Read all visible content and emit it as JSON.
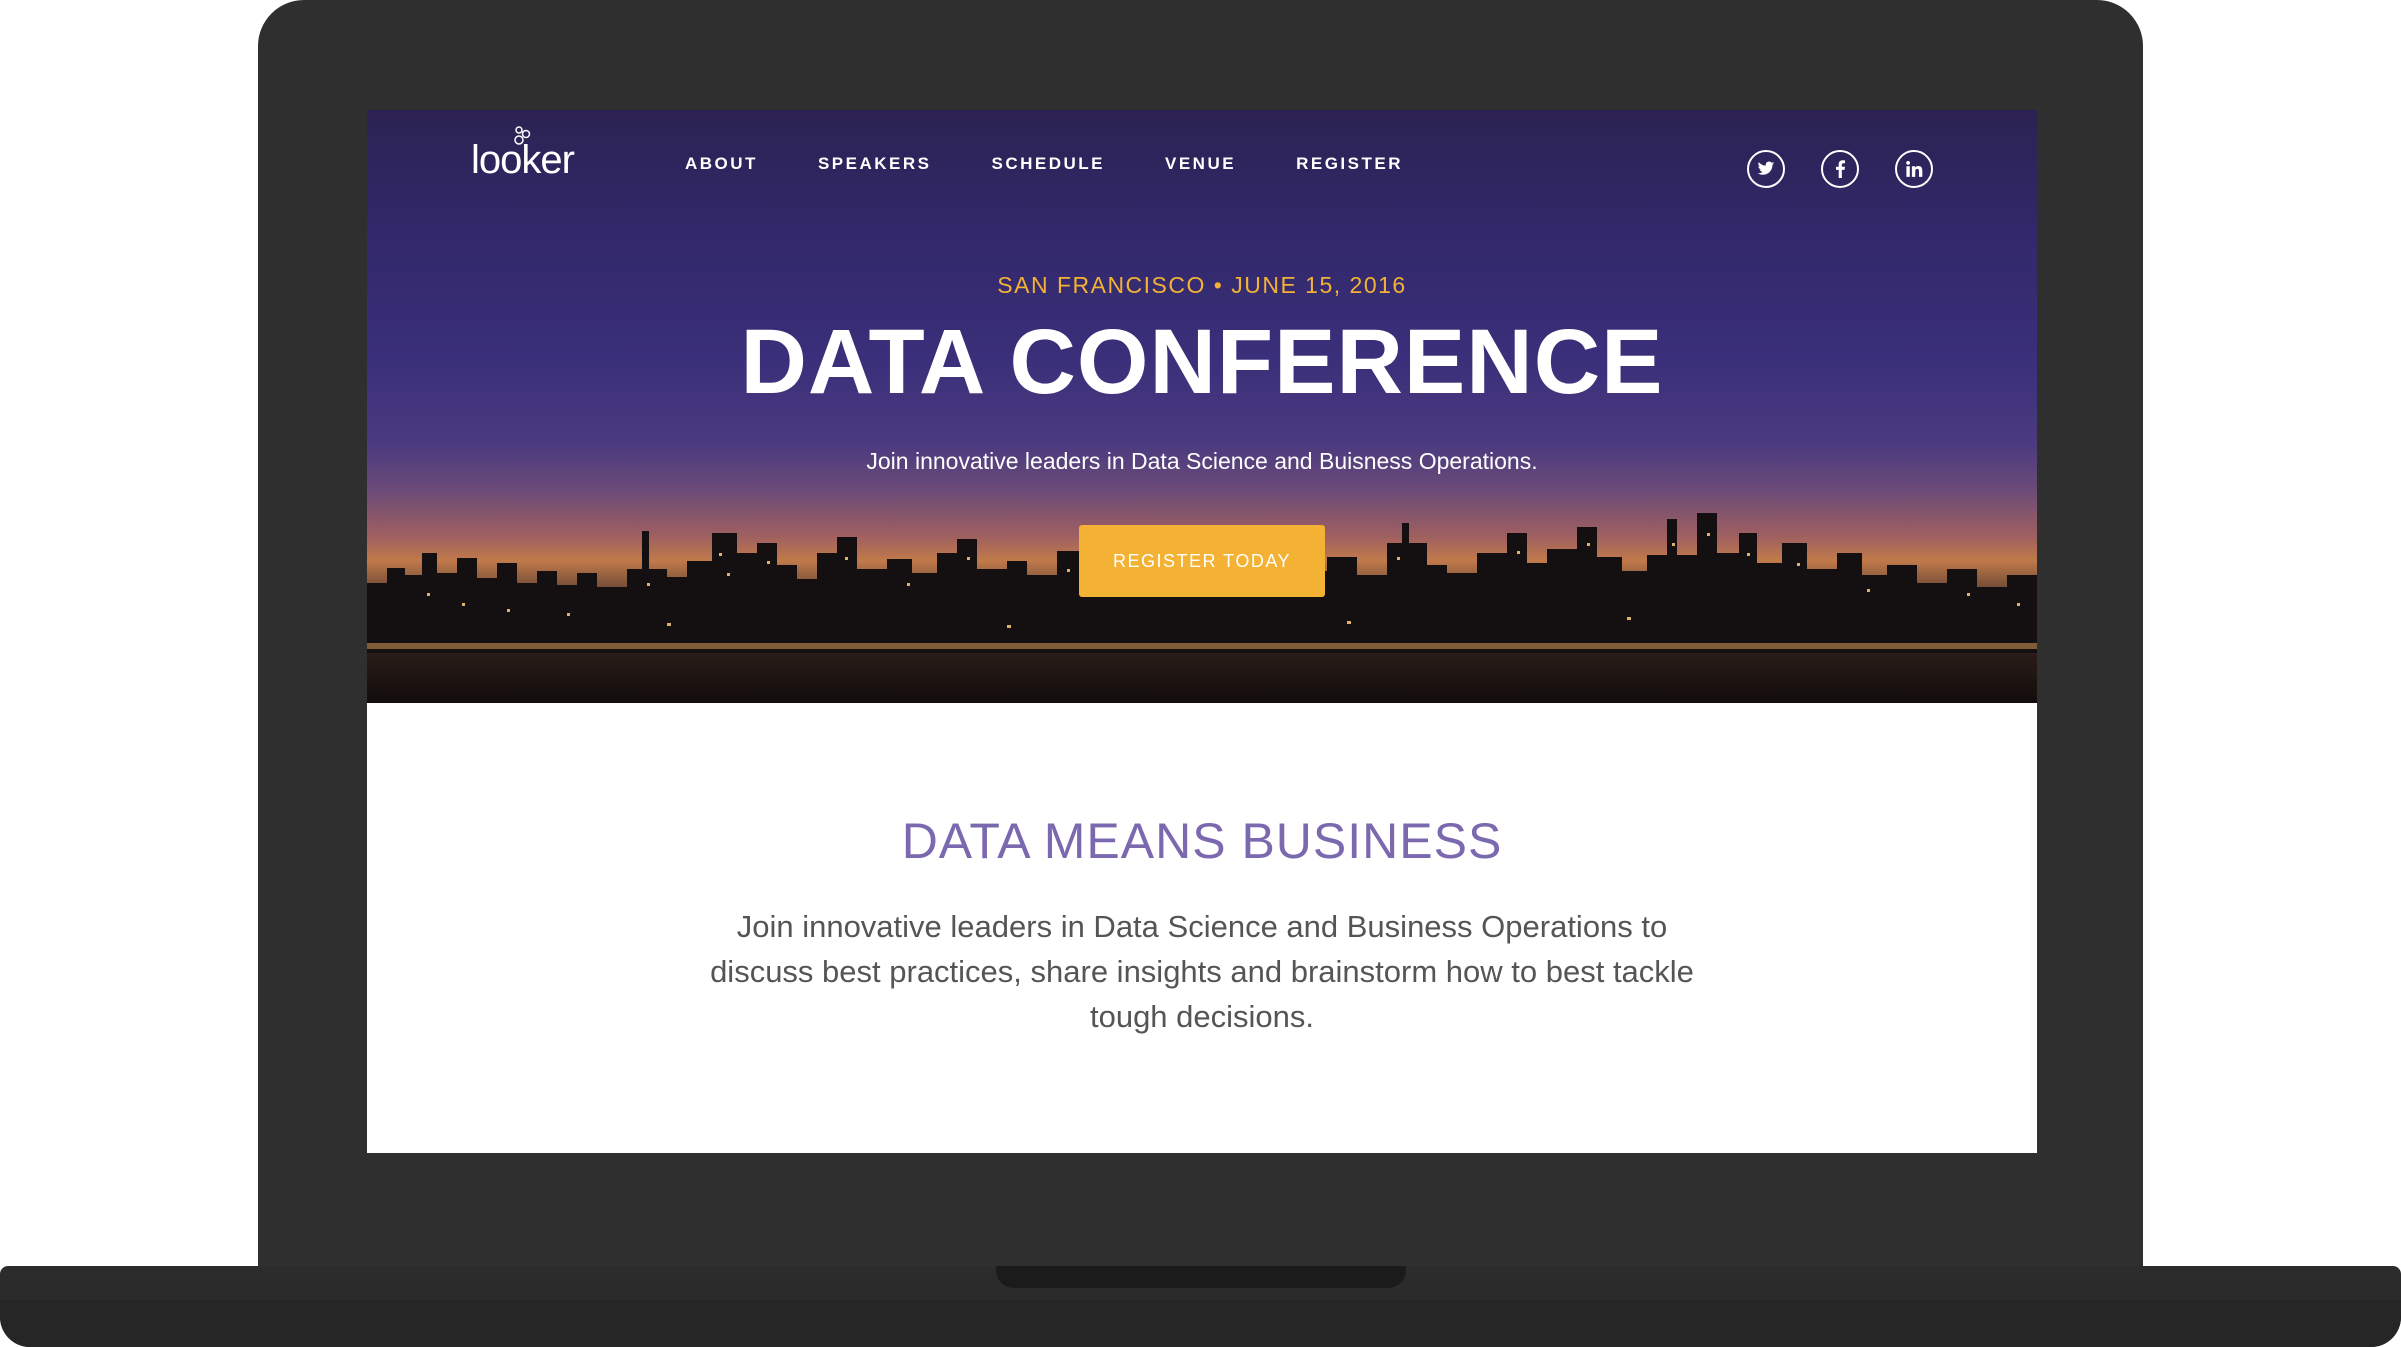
{
  "nav": {
    "logo_text": "looker",
    "links": [
      "ABOUT",
      "SPEAKERS",
      "SCHEDULE",
      "VENUE",
      "REGISTER"
    ],
    "social_icons": [
      "twitter-icon",
      "facebook-icon",
      "linkedin-icon"
    ]
  },
  "hero": {
    "eyebrow": "SAN FRANCISCO • JUNE 15, 2016",
    "title": "DATA CONFERENCE",
    "subtitle": "Join innovative leaders in Data Science and Buisness Operations.",
    "cta_label": "REGISTER TODAY"
  },
  "section": {
    "title": "DATA MEANS BUSINESS",
    "body": "Join innovative leaders in Data Science and Business Operations to discuss best practices, share insights and brainstorm how to best tackle tough decisions."
  },
  "colors": {
    "accent": "#f3b233",
    "section_title": "#7b69b0",
    "hero_top": "#2b2252",
    "bezel": "#2f2f2f"
  }
}
